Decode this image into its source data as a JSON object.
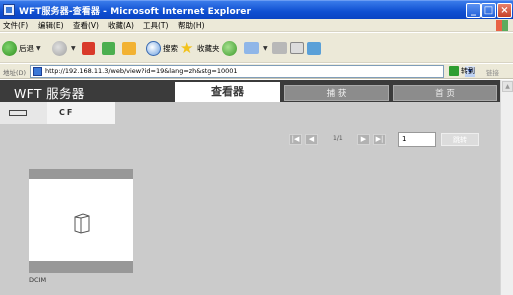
{
  "window": {
    "title": "WFT服务器-查看器 - Microsoft Internet Explorer",
    "controls": [
      "minimize",
      "maximize",
      "close"
    ],
    "accent": "#0a44c4"
  },
  "menu": {
    "items": [
      "文件(F)",
      "编辑(E)",
      "查看(V)",
      "收藏(A)",
      "工具(T)",
      "帮助(H)"
    ]
  },
  "toolbar": {
    "back_label": "后退",
    "search_label": "搜索",
    "favorites_label": "收藏夹"
  },
  "address": {
    "label": "地址(D)",
    "url": "http://192.168.11.3/web/view?id=19&lang=zh&stg=10001",
    "go_label": "转到",
    "links_label": "链接"
  },
  "app": {
    "brand": "WFT 服务器",
    "tabs": [
      {
        "label": "查看器",
        "active": true
      },
      {
        "label": "捕 获",
        "active": false
      },
      {
        "label": "首 页",
        "active": false
      }
    ],
    "cards": [
      {
        "label": "",
        "icon": "cf-card-icon"
      },
      {
        "label": "CF",
        "active": true
      }
    ],
    "pagination": {
      "page_info": "1/1",
      "page_value": "1",
      "move_label": "跳转",
      "buttons": [
        "first-page",
        "prev-page",
        "next-page",
        "last-page"
      ]
    },
    "folders": [
      {
        "name": "DCIM",
        "icon": "folder-icon"
      }
    ]
  },
  "colors": {
    "header_bg": "#3b3b3b",
    "page_bg": "#cbcbcb",
    "active_tab_bg": "#ffffff",
    "inactive_tab_bg": "#8c8c8c"
  }
}
